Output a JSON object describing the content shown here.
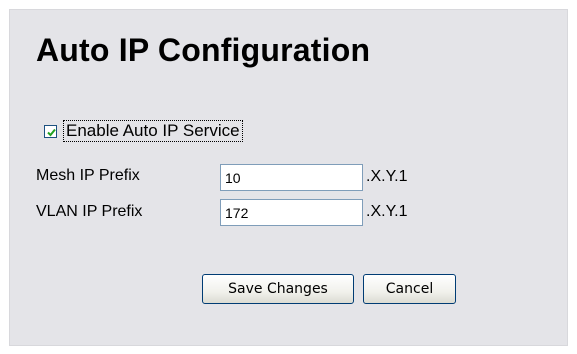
{
  "page": {
    "title": "Auto IP Configuration"
  },
  "enable_auto_ip": {
    "label": "Enable Auto IP Service",
    "checked": true
  },
  "mesh_ip": {
    "label": "Mesh IP Prefix",
    "value": "10",
    "suffix": ".X.Y.1"
  },
  "vlan_ip": {
    "label": "VLAN IP Prefix",
    "value": "172",
    "suffix": ".X.Y.1"
  },
  "actions": {
    "save_label": "Save Changes",
    "cancel_label": "Cancel"
  },
  "colors": {
    "panel_background": "#e4e4e8",
    "checkmark": "#21a121",
    "button_border": "#003c74"
  },
  "icons": {
    "checkbox_mark": "checkmark-icon"
  }
}
